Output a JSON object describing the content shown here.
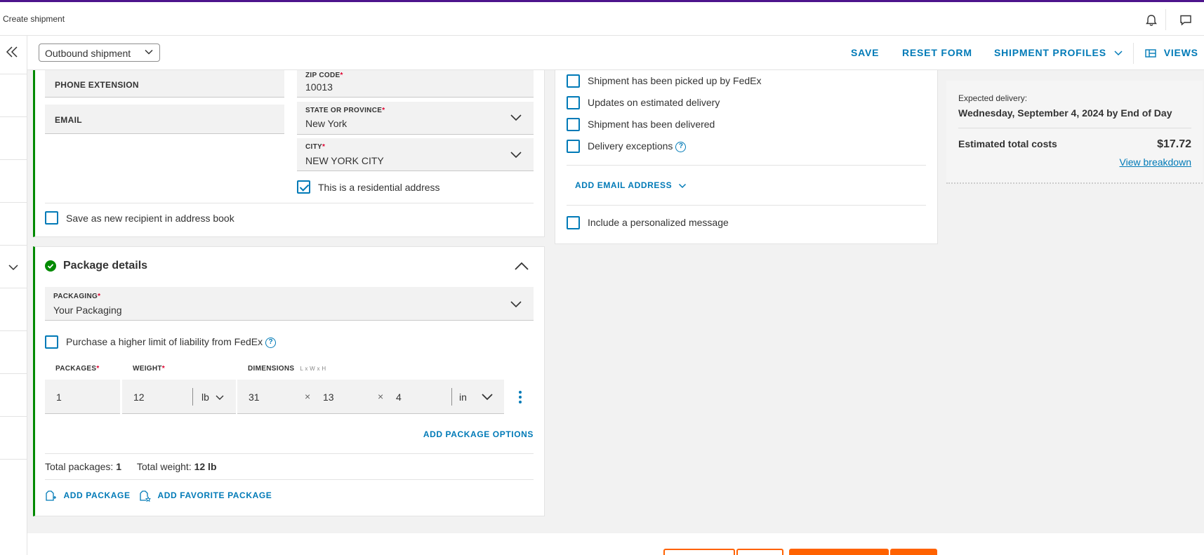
{
  "topbar": {
    "title": "Create shipment",
    "bell_icon": "bell-icon",
    "chat_icon": "chat-icon"
  },
  "toolbar": {
    "shipment_type": "Outbound shipment",
    "save_label": "SAVE",
    "reset_label": "RESET FORM",
    "profiles_label": "SHIPMENT PROFILES",
    "views_label": "VIEWS"
  },
  "recipient": {
    "phone_ext_label": "PHONE EXTENSION",
    "email_label": "EMAIL",
    "zip_label": "ZIP CODE",
    "zip_value": "10013",
    "state_label": "STATE OR PROVINCE",
    "state_value": "New York",
    "city_label": "CITY",
    "city_value": "NEW YORK CITY",
    "residential_label": "This is a residential address",
    "residential_checked": true,
    "save_recipient_label": "Save as new recipient in address book"
  },
  "notifications": {
    "items": [
      "Shipment has been picked up by FedEx",
      "Updates on estimated delivery",
      "Shipment has been delivered",
      "Delivery exceptions"
    ],
    "add_email_label": "ADD EMAIL ADDRESS",
    "personal_msg_label": "Include a personalized message"
  },
  "package": {
    "title": "Package details",
    "packaging_label": "PACKAGING",
    "packaging_value": "Your Packaging",
    "liability_label": "Purchase a higher limit of liability from FedEx",
    "packages_label": "PACKAGES",
    "weight_label": "WEIGHT",
    "dimensions_label": "DIMENSIONS",
    "dimensions_hint": "L x W x H",
    "packages_value": "1",
    "weight_value": "12",
    "weight_unit": "lb",
    "dim_l": "31",
    "dim_w": "13",
    "dim_h": "4",
    "dim_unit": "in",
    "times": "×",
    "add_options_label": "ADD PACKAGE OPTIONS",
    "total_packages_label": "Total packages:",
    "total_packages_value": "1",
    "total_weight_label": "Total weight:",
    "total_weight_value": "12 lb",
    "add_package_label": "ADD PACKAGE",
    "add_favorite_label": "ADD FAVORITE PACKAGE"
  },
  "summary": {
    "expected_label": "Expected delivery:",
    "expected_value": "Wednesday, September 4, 2024 by End of Day",
    "cost_label": "Estimated total costs",
    "cost_value": "$17.72",
    "breakdown_label": "View breakdown"
  },
  "colors": {
    "brand_purple": "#4d148c",
    "link_blue": "#007ab7",
    "success_green": "#008a00",
    "cta_orange": "#ff6200",
    "required_red": "#de002e"
  }
}
